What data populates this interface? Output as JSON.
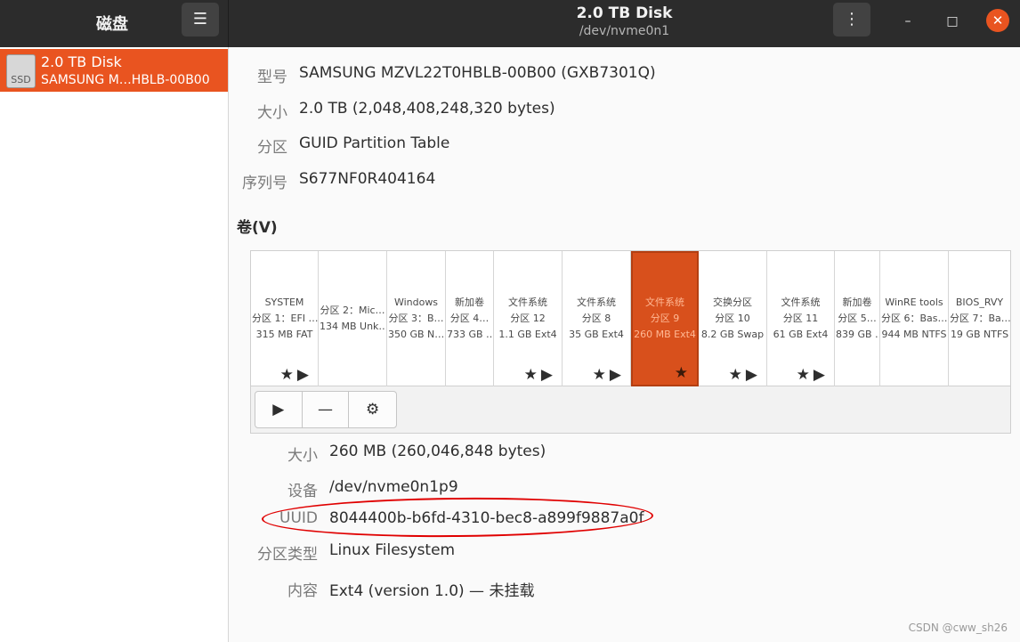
{
  "header": {
    "app_title": "磁盘",
    "menu_icon": "hamburger-icon",
    "disk_title": "2.0 TB Disk",
    "disk_subtitle": "/dev/nvme0n1",
    "options_icon": "vertical-dots-icon"
  },
  "window_controls": {
    "minimize": "–",
    "maximize": "□",
    "close": "✕"
  },
  "sidebar": {
    "items": [
      {
        "icon_text": "SSD",
        "name": "2.0 TB Disk",
        "model": "SAMSUNG M…HBLB-00B00",
        "selected": true
      }
    ]
  },
  "disk_info": [
    {
      "label": "型号",
      "value": "SAMSUNG MZVL22T0HBLB-00B00 (GXB7301Q)"
    },
    {
      "label": "大小",
      "value": "2.0 TB (2,048,408,248,320 bytes)"
    },
    {
      "label": "分区",
      "value": "GUID Partition Table"
    },
    {
      "label": "序列号",
      "value": "S677NF0R404164"
    }
  ],
  "volumes_title": "卷(V)",
  "partitions": [
    {
      "l1": "SYSTEM",
      "l2": "分区 1：EFI …",
      "l3": "315 MB FAT",
      "icons": "★▶"
    },
    {
      "l1": "",
      "l2": "分区 2：Mic…",
      "l3": "134 MB Unk…",
      "icons": ""
    },
    {
      "l1": "Windows",
      "l2": "分区 3：B…",
      "l3": "350 GB N…",
      "icons": ""
    },
    {
      "l1": "新加卷",
      "l2": "分区 4…",
      "l3": "733 GB …",
      "icons": ""
    },
    {
      "l1": "文件系统",
      "l2": "分区 12",
      "l3": "1.1 GB Ext4",
      "icons": "★▶"
    },
    {
      "l1": "文件系统",
      "l2": "分区 8",
      "l3": "35 GB Ext4",
      "icons": "★▶"
    },
    {
      "l1": "文件系统",
      "l2": "分区 9",
      "l3": "260 MB Ext4",
      "icons": "★",
      "selected": true
    },
    {
      "l1": "交换分区",
      "l2": "分区 10",
      "l3": "8.2 GB Swap",
      "icons": "★▶"
    },
    {
      "l1": "文件系统",
      "l2": "分区 11",
      "l3": "61 GB Ext4",
      "icons": "★▶"
    },
    {
      "l1": "新加卷",
      "l2": "分区 5…",
      "l3": "839 GB …",
      "icons": ""
    },
    {
      "l1": "WinRE tools",
      "l2": "分区 6：Bas…",
      "l3": "944 MB NTFS",
      "icons": ""
    },
    {
      "l1": "BIOS_RVY",
      "l2": "分区 7：Ba…",
      "l3": "19 GB NTFS",
      "icons": ""
    }
  ],
  "toolbar": {
    "play": "▶",
    "minus": "—",
    "gears": "⚙"
  },
  "volume_info": [
    {
      "label": "大小",
      "value": "260 MB (260,046,848 bytes)"
    },
    {
      "label": "设备",
      "value": "/dev/nvme0n1p9"
    },
    {
      "label": "UUID",
      "value": "8044400b-b6fd-4310-bec8-a899f9887a0f"
    },
    {
      "label": "分区类型",
      "value": "Linux Filesystem"
    },
    {
      "label": "内容",
      "value": "Ext4 (version 1.0) — 未挂载"
    }
  ],
  "watermark": "CSDN @cww_sh26",
  "colors": {
    "accent": "#e95420",
    "header": "#2c2c2c",
    "annotation": "#e00000"
  }
}
